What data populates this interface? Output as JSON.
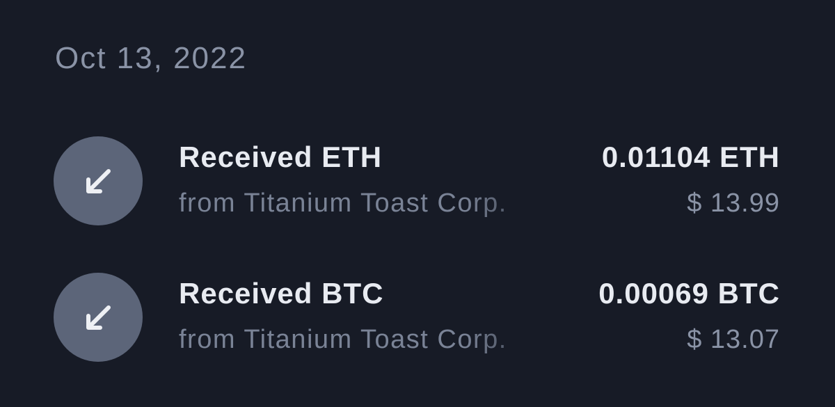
{
  "date_header": "Oct 13, 2022",
  "colors": {
    "background": "#171b26",
    "icon_bg": "#5c6579",
    "primary_text": "#e8ebf1",
    "secondary_text": "#8a93a6"
  },
  "transactions": [
    {
      "icon": "arrow-down-left-icon",
      "title": "Received ETH",
      "subtitle": "from Titanium Toast Corp.",
      "amount": "0.01104 ETH",
      "fiat": "$ 13.99"
    },
    {
      "icon": "arrow-down-left-icon",
      "title": "Received BTC",
      "subtitle": "from Titanium Toast Corp.",
      "amount": "0.00069 BTC",
      "fiat": "$ 13.07"
    }
  ]
}
